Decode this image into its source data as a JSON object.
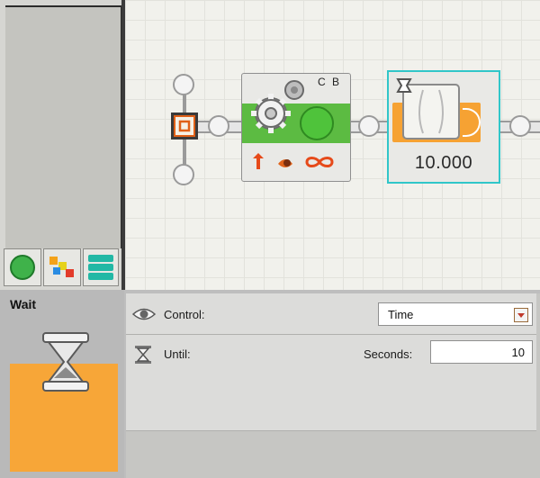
{
  "palette": {
    "tabs": [
      {
        "name": "common-palette",
        "icon": "green-circle-icon"
      },
      {
        "name": "complete-palette",
        "icon": "colored-squares-icon"
      },
      {
        "name": "custom-palette",
        "icon": "stacked-bars-icon"
      }
    ]
  },
  "canvas": {
    "loop_block": {
      "ports_label": "C B"
    },
    "wait_block": {
      "value": "10.000"
    }
  },
  "config": {
    "block_title": "Wait",
    "control_label": "Control:",
    "control_value": "Time",
    "until_label": "Until:",
    "seconds_label": "Seconds:",
    "seconds_value": "10"
  },
  "colors": {
    "loop_green": "#5cbb42",
    "wait_orange": "#f6a233",
    "selection_cyan": "#30c6c9"
  }
}
